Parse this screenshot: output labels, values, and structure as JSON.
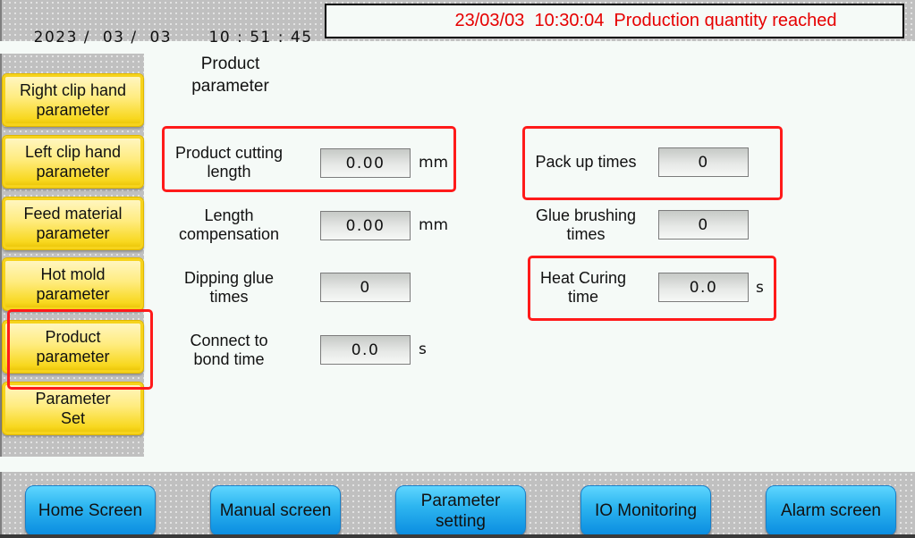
{
  "header": {
    "date": {
      "year": "2023",
      "month": "03",
      "day": "03",
      "separator": "/"
    },
    "time": {
      "hour": "10",
      "minute": "51",
      "second": "45",
      "separator": ":"
    },
    "alarm_message": "23/03/03  10:30:04  Production quantity reached",
    "alarm_color": "#e60000"
  },
  "sidebar": {
    "items": [
      {
        "label": "Right clip hand\nparameter"
      },
      {
        "label": "Left clip hand\nparameter"
      },
      {
        "label": "Feed material\nparameter"
      },
      {
        "label": "Hot mold\nparameter"
      },
      {
        "label": "Product\nparameter",
        "selected": true
      },
      {
        "label": "Parameter\nSet"
      }
    ]
  },
  "main": {
    "title": "Product\nparameter",
    "left_params": [
      {
        "label": "Product cutting\nlength",
        "value": "0.00",
        "unit": "mm",
        "highlighted": true
      },
      {
        "label": "Length\ncompensation",
        "value": "0.00",
        "unit": "mm"
      },
      {
        "label": "Dipping glue\ntimes",
        "value": "0",
        "unit": ""
      },
      {
        "label": "Connect to\nbond time",
        "value": "0.0",
        "unit": "s"
      }
    ],
    "right_params": [
      {
        "label": "Pack up times",
        "value": "0",
        "unit": "",
        "highlighted": true
      },
      {
        "label": "Glue brushing\ntimes",
        "value": "0",
        "unit": ""
      },
      {
        "label": "Heat Curing\ntime",
        "value": "0.0",
        "unit": "s",
        "highlighted": true
      }
    ]
  },
  "footer": {
    "buttons": [
      {
        "label": "Home Screen"
      },
      {
        "label": "Manual screen"
      },
      {
        "label": "Parameter\nsetting"
      },
      {
        "label": "IO Monitoring"
      },
      {
        "label": "Alarm screen"
      }
    ]
  },
  "colors": {
    "highlight": "#ff1a1a",
    "side_button": "#f8d820",
    "nav_button": "#2eb6f0"
  }
}
